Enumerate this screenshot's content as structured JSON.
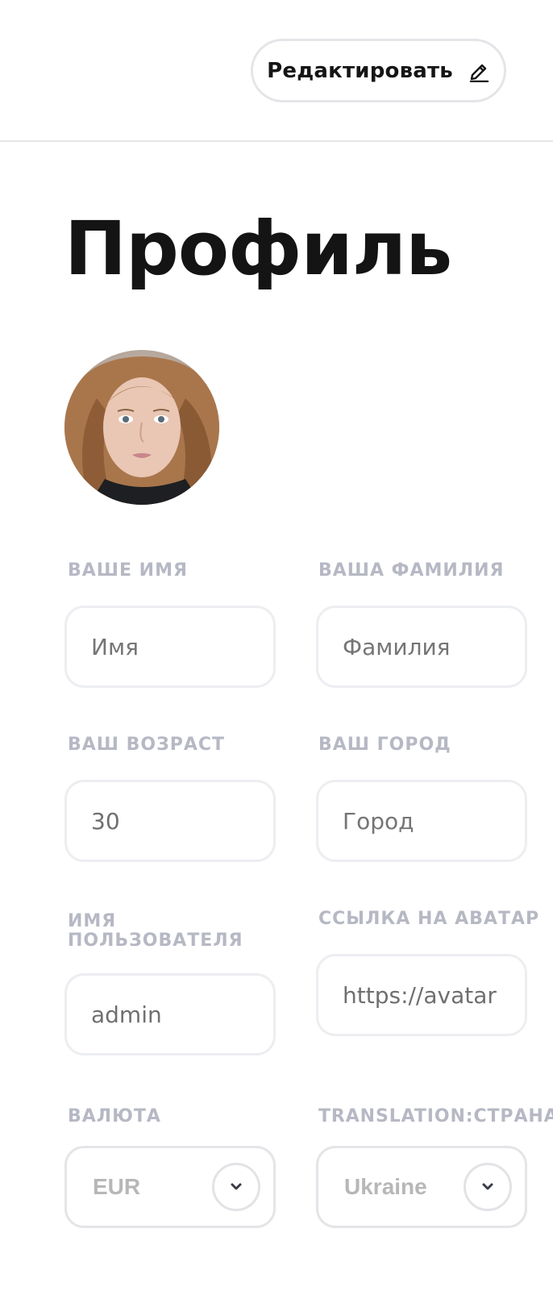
{
  "header": {
    "edit_label": "Редактировать",
    "edit_icon": "pencil-icon"
  },
  "page": {
    "title": "Профиль"
  },
  "avatar": {
    "alt": "avatar"
  },
  "form": {
    "first_name": {
      "label": "ВАШЕ ИМЯ",
      "value": "",
      "placeholder": "Имя"
    },
    "last_name": {
      "label": "ВАША ФАМИЛИЯ",
      "value": "",
      "placeholder": "Фамилия"
    },
    "age": {
      "label": "ВАШ ВОЗРАСТ",
      "value": "30",
      "placeholder": ""
    },
    "city": {
      "label": "ВАШ ГОРОД",
      "value": "",
      "placeholder": "Город"
    },
    "username": {
      "label": "ИМЯ ПОЛЬЗОВАТЕЛЯ",
      "value": "admin",
      "placeholder": ""
    },
    "avatar_link": {
      "label": "ССЫЛКА НА АВАТАР",
      "value": "https://avatar",
      "placeholder": ""
    },
    "currency": {
      "label": "ВАЛЮТА",
      "value": "EUR",
      "icon": "chevron-down-icon"
    },
    "country": {
      "label": "TRANSLATION:СТРАНА",
      "value": "Ukraine",
      "icon": "chevron-down-icon"
    }
  },
  "colors": {
    "text": "#151515",
    "label": "#b6b8c4",
    "border": "#e4e5e8"
  }
}
